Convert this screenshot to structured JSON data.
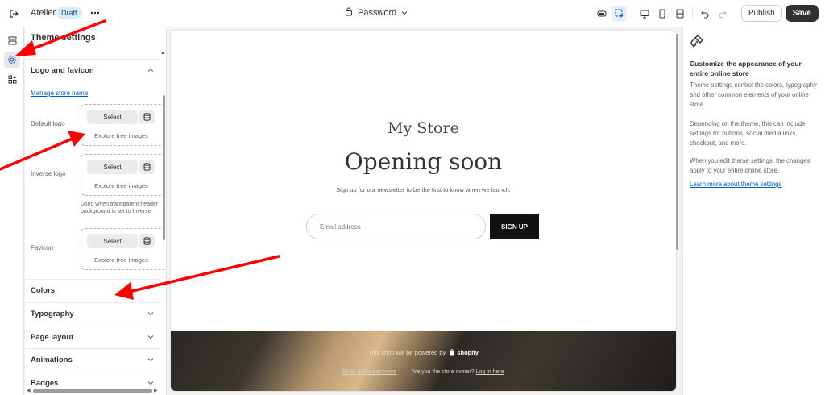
{
  "topbar": {
    "app_name": "Atelier",
    "badge": "Draft",
    "page_selector": "Password",
    "publish_label": "Publish",
    "save_label": "Save",
    "icons": [
      "exit-icon",
      "more-icon",
      "lock-icon",
      "chevron-down-icon",
      "inspector-icon",
      "select-element-icon",
      "desktop-icon",
      "mobile-icon",
      "full-width-icon",
      "undo-icon",
      "redo-icon"
    ]
  },
  "rail": {
    "items": [
      "sections-icon",
      "theme-settings-icon",
      "app-embeds-icon"
    ],
    "active": "theme-settings-icon"
  },
  "panel": {
    "title": "Theme settings",
    "logo_section": {
      "title": "Logo and favicon",
      "manage_link": "Manage store name",
      "fields": [
        {
          "label": "Default logo",
          "select": "Select",
          "explore": "Explore free images"
        },
        {
          "label": "Inverse logo",
          "select": "Select",
          "explore": "Explore free images",
          "help": "Used when transparent header background is set to Inverse"
        },
        {
          "label": "Favicon",
          "select": "Select",
          "explore": "Explore free images"
        }
      ]
    },
    "sections": [
      {
        "title": "Colors"
      },
      {
        "title": "Typography"
      },
      {
        "title": "Page layout"
      },
      {
        "title": "Animations"
      },
      {
        "title": "Badges"
      }
    ]
  },
  "preview": {
    "store_name": "My Store",
    "heading": "Opening soon",
    "subtext": "Sign up for our newsletter to be the first to know when we launch.",
    "email_placeholder": "Email address",
    "signup_label": "SIGN UP",
    "footer": {
      "powered_by": "This shop will be powered by",
      "shopify": "shopify",
      "enter_password": "Enter using password",
      "owner_question": "Are you the store owner?",
      "login": "Log in here"
    }
  },
  "info": {
    "title": "Customize the appearance of your entire online store",
    "p1": "Theme settings control the colors, typography and other common elements of your online store.",
    "p2": "Depending on the theme, this can include settings for buttons, social media links, checkout, and more.",
    "p3": "When you edit theme settings, the changes apply to your entire online store.",
    "link": "Learn more about theme settings"
  },
  "colors": {
    "accent": "#005bd3",
    "annotation_arrow": "#ff0000",
    "save_bg": "#303030"
  }
}
